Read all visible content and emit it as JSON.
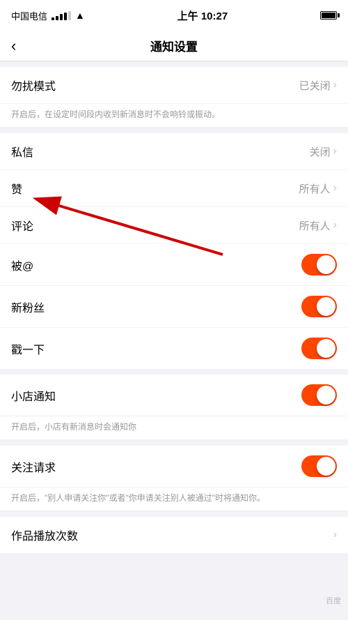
{
  "statusBar": {
    "carrier": "中国电信",
    "time": "上午 10:27"
  },
  "navBar": {
    "title": "通知设置",
    "backLabel": "‹"
  },
  "sections": [
    {
      "id": "dnd",
      "rows": [
        {
          "id": "dnd-mode",
          "label": "勿扰模式",
          "value": "已关闭",
          "type": "link"
        }
      ],
      "hint": "开启后，在设定时间段内收到新消息时不会响铃或振动。"
    },
    {
      "id": "messages",
      "rows": [
        {
          "id": "private-message",
          "label": "私信",
          "value": "关闭",
          "type": "link"
        },
        {
          "id": "likes",
          "label": "赞",
          "value": "所有人",
          "type": "link"
        },
        {
          "id": "comments",
          "label": "评论",
          "value": "所有人",
          "type": "link"
        },
        {
          "id": "at-mention",
          "label": "被@",
          "value": "",
          "type": "toggle",
          "toggleState": "on"
        },
        {
          "id": "new-fans",
          "label": "新粉丝",
          "value": "",
          "type": "toggle",
          "toggleState": "on"
        },
        {
          "id": "challenge",
          "label": "戳一下",
          "value": "",
          "type": "toggle",
          "toggleState": "on"
        }
      ]
    },
    {
      "id": "shop",
      "rows": [
        {
          "id": "shop-notice",
          "label": "小店通知",
          "value": "",
          "type": "toggle",
          "toggleState": "on"
        }
      ],
      "hint": "开启后，小店有新消息时会通知你"
    },
    {
      "id": "follow",
      "rows": [
        {
          "id": "follow-request",
          "label": "关注请求",
          "value": "",
          "type": "toggle",
          "toggleState": "on"
        }
      ],
      "hint": "开启后，\"别人申请关注你\"或者\"你申请关注别人被通过\"时将通知你。"
    },
    {
      "id": "playcount",
      "rows": [
        {
          "id": "play-count",
          "label": "作品播放次数",
          "value": "",
          "type": "link-no-value"
        }
      ]
    }
  ],
  "colors": {
    "toggleOn": "#ff4500",
    "accent": "#ff4500"
  }
}
